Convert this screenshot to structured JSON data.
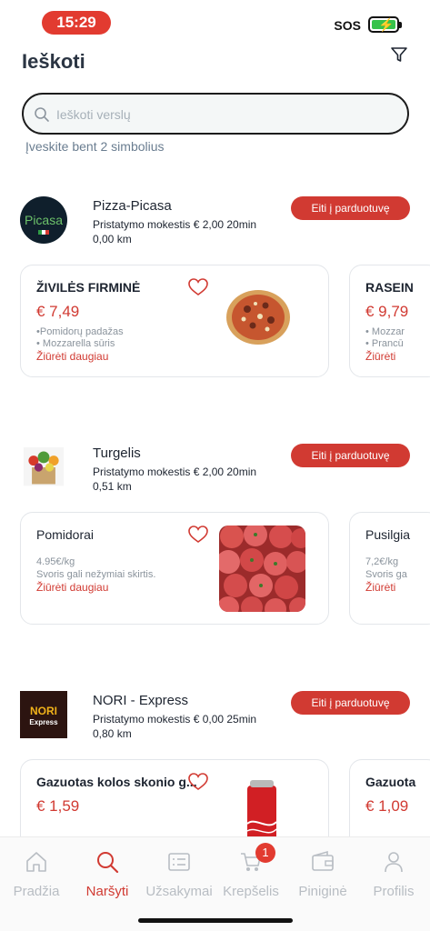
{
  "status": {
    "time": "15:29",
    "sos": "SOS"
  },
  "header": {
    "title": "Ieškoti"
  },
  "search": {
    "placeholder": "Ieškoti verslų",
    "value": "",
    "hint": "Įveskite bent 2 simbolius"
  },
  "shops": [
    {
      "name": "Pizza-Picasa",
      "fee": "Pristatymo mokestis € 2,00 20min",
      "distance": "0,00 km",
      "button": "Eiti į parduotuvę",
      "logo_text": "Picasa",
      "products": [
        {
          "name": "ŽIVILĖS FIRMINĖ",
          "price": "€ 7,49",
          "lines": [
            "•Pomidorų padažas",
            "• Mozzarella sūris"
          ],
          "more": "Žiūrėti daugiau"
        },
        {
          "name": "RASEIN",
          "price": "€ 9,79",
          "lines": [
            "• Mozzar",
            "• Prancū"
          ],
          "more": "Žiūrėti"
        }
      ]
    },
    {
      "name": "Turgelis",
      "fee": "Pristatymo mokestis € 2,00 20min",
      "distance": "0,51 km",
      "button": "Eiti į parduotuvę",
      "products": [
        {
          "name": "Pomidorai",
          "price": "",
          "lines": [
            "4.95€/kg",
            "Svoris gali nežymiai skirtis."
          ],
          "more": "Žiūrėti daugiau"
        },
        {
          "name": "Pusilgia",
          "price": "",
          "lines": [
            "7,2€/kg",
            "Svoris ga"
          ],
          "more": "Žiūrėti"
        }
      ]
    },
    {
      "name": "NORI - Express",
      "fee": "Pristatymo mokestis € 0,00 25min",
      "distance": "0,80 km",
      "button": "Eiti į parduotuvę",
      "logo_text": [
        "NORI",
        "Express"
      ],
      "products": [
        {
          "name": "Gazuotas kolos skonio g...",
          "price": "€ 1,59",
          "lines": [],
          "more": ""
        },
        {
          "name": "Gazuota",
          "price": "€ 1,09",
          "lines": [],
          "more": ""
        }
      ]
    }
  ],
  "tabs": [
    {
      "label": "Pradžia",
      "icon": "home-icon",
      "active": false
    },
    {
      "label": "Naršyti",
      "icon": "search-icon",
      "active": true
    },
    {
      "label": "Užsakymai",
      "icon": "orders-icon",
      "active": false
    },
    {
      "label": "Krepšelis",
      "icon": "cart-icon",
      "active": false,
      "badge": "1"
    },
    {
      "label": "Piniginė",
      "icon": "wallet-icon",
      "active": false
    },
    {
      "label": "Profilis",
      "icon": "profile-icon",
      "active": false
    }
  ],
  "colors": {
    "accent": "#d13a32",
    "badge": "#e23b30",
    "text": "#1d2430",
    "muted": "#8a939c",
    "tab_inactive": "#b8bdc3"
  }
}
